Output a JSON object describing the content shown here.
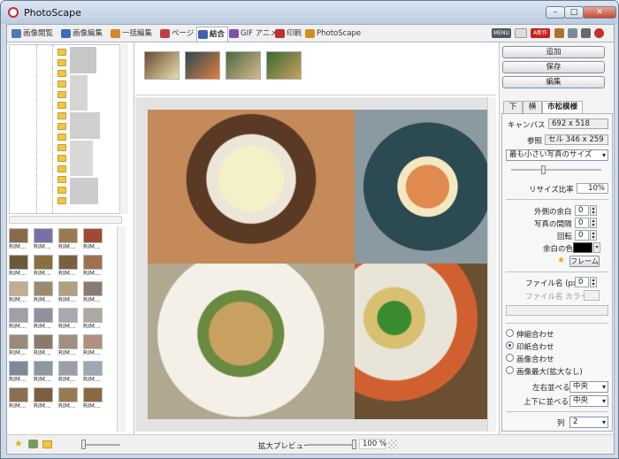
{
  "window": {
    "title": "PhotoScape",
    "min": "–",
    "max": "□",
    "close": "✕"
  },
  "tabs": [
    {
      "label": "画像閲覧",
      "color": "#4a7ab8"
    },
    {
      "label": "画像編集",
      "color": "#3a6fc0"
    },
    {
      "label": "一括編集",
      "color": "#d08a2a"
    },
    {
      "label": "ページ",
      "color": "#c04040"
    },
    {
      "label": "結合",
      "color": "#4060b0"
    },
    {
      "label": "GIF アニメ",
      "color": "#8050b0"
    },
    {
      "label": "印刷",
      "color": "#c03030"
    },
    {
      "label": "PhotoScape",
      "color": "#d09020"
    }
  ],
  "top_icons": {
    "menu": "MENU",
    "ad": "A新作"
  },
  "thumb_label": "RIM...",
  "actions": {
    "add": "追加",
    "save": "保存",
    "edit": "編集"
  },
  "right_tabs": [
    "下",
    "横",
    "市松模様"
  ],
  "panel": {
    "canvas_label": "キャンバス",
    "canvas_value": "692 x 518",
    "ref_label": "参照",
    "ref_value": "セル 346 x 259",
    "size_mode": "最も小さい写真のサイズ",
    "resize_label": "リサイズ比率",
    "resize_value": "10%",
    "outer_margin_label": "外側の余白",
    "outer_margin_value": "0",
    "gap_label": "写真の間隔",
    "gap_value": "0",
    "rotate_label": "回転",
    "rotate_value": "0",
    "margin_color_label": "余白の色",
    "frame_button": "フレーム",
    "filename_label": "ファイル名 (px)",
    "filename_value": "0",
    "filename_color_label": "ファイル名 カラー",
    "fit_options": [
      "伸縮合わせ",
      "印紙合わせ",
      "画像合わせ",
      "画像最大(拡大なし)"
    ],
    "fit_selected": 1,
    "halign_label": "左右並べる",
    "halign_value": "中央",
    "valign_label": "上下に並べる",
    "valign_value": "中央",
    "columns_label": "列",
    "columns_value": "2"
  },
  "bottom": {
    "zoom_label": "拡大プレビュー",
    "zoom_value": "100 %"
  },
  "colors": {
    "accent": "#1a4fa0",
    "margin_color": "#000000"
  }
}
